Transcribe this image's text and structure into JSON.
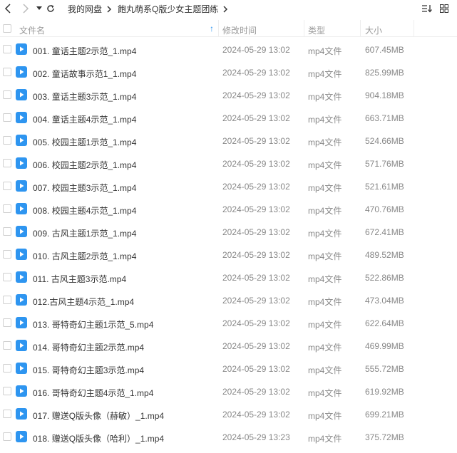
{
  "toolbar": {
    "back_icon": "chevron-left-icon",
    "forward_icon": "chevron-right-icon",
    "history_icon": "caret-down-icon",
    "refresh_icon": "refresh-icon",
    "breadcrumbs": [
      {
        "label": "我的网盘"
      },
      {
        "label": "飽丸萌系Q版少女主题团练"
      }
    ],
    "sort_icon": "sort-icon",
    "grid_icon": "grid-view-icon"
  },
  "header": {
    "name": "文件名",
    "modified": "修改时间",
    "type": "类型",
    "size": "大小",
    "sort_arrow": "↑"
  },
  "colors": {
    "file_icon": "#2e95f0",
    "header_text": "#9a9a9a",
    "row_text": "#333333",
    "meta_text": "#888888"
  },
  "files": [
    {
      "name": "001. 童话主题2示范_1.mp4",
      "modified": "2024-05-29 13:02",
      "type": "mp4文件",
      "size": "607.45MB"
    },
    {
      "name": "002. 童话故事示范1_1.mp4",
      "modified": "2024-05-29 13:02",
      "type": "mp4文件",
      "size": "825.99MB"
    },
    {
      "name": "003. 童话主题3示范_1.mp4",
      "modified": "2024-05-29 13:02",
      "type": "mp4文件",
      "size": "904.18MB"
    },
    {
      "name": "004. 童话主题4示范_1.mp4",
      "modified": "2024-05-29 13:02",
      "type": "mp4文件",
      "size": "663.71MB"
    },
    {
      "name": "005. 校园主题1示范_1.mp4",
      "modified": "2024-05-29 13:02",
      "type": "mp4文件",
      "size": "524.66MB"
    },
    {
      "name": "006. 校园主题2示范_1.mp4",
      "modified": "2024-05-29 13:02",
      "type": "mp4文件",
      "size": "571.76MB"
    },
    {
      "name": "007. 校园主题3示范_1.mp4",
      "modified": "2024-05-29 13:02",
      "type": "mp4文件",
      "size": "521.61MB"
    },
    {
      "name": "008. 校园主题4示范_1.mp4",
      "modified": "2024-05-29 13:02",
      "type": "mp4文件",
      "size": "470.76MB"
    },
    {
      "name": "009. 古风主题1示范_1.mp4",
      "modified": "2024-05-29 13:02",
      "type": "mp4文件",
      "size": "672.41MB"
    },
    {
      "name": "010. 古风主题2示范_1.mp4",
      "modified": "2024-05-29 13:02",
      "type": "mp4文件",
      "size": "489.52MB"
    },
    {
      "name": "011. 古风主题3示范.mp4",
      "modified": "2024-05-29 13:02",
      "type": "mp4文件",
      "size": "522.86MB"
    },
    {
      "name": "012.古风主题4示范_1.mp4",
      "modified": "2024-05-29 13:02",
      "type": "mp4文件",
      "size": "473.04MB"
    },
    {
      "name": "013. 哥特奇幻主题1示范_5.mp4",
      "modified": "2024-05-29 13:02",
      "type": "mp4文件",
      "size": "622.64MB"
    },
    {
      "name": "014. 哥特奇幻主题2示范.mp4",
      "modified": "2024-05-29 13:02",
      "type": "mp4文件",
      "size": "469.99MB"
    },
    {
      "name": "015. 哥特奇幻主题3示范.mp4",
      "modified": "2024-05-29 13:02",
      "type": "mp4文件",
      "size": "555.72MB"
    },
    {
      "name": "016. 哥特奇幻主题4示范_1.mp4",
      "modified": "2024-05-29 13:02",
      "type": "mp4文件",
      "size": "619.92MB"
    },
    {
      "name": "017. 赠送Q版头像（赫敏）_1.mp4",
      "modified": "2024-05-29 13:02",
      "type": "mp4文件",
      "size": "699.21MB"
    },
    {
      "name": "018. 赠送Q版头像（哈利）_1.mp4",
      "modified": "2024-05-29 13:23",
      "type": "mp4文件",
      "size": "375.72MB"
    }
  ]
}
